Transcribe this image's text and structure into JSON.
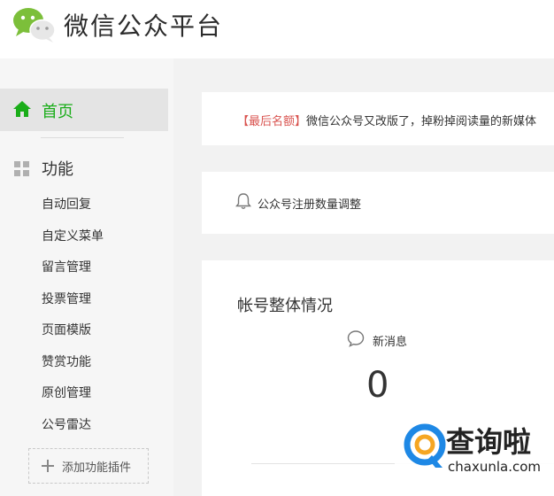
{
  "header": {
    "title": "微信公众平台",
    "logo_icon": "wechat-logo-icon"
  },
  "sidebar": {
    "home": {
      "label": "首页",
      "icon": "home-icon",
      "color": "#1aad19"
    },
    "function_section": {
      "label": "功能",
      "icon": "grid-icon"
    },
    "items": [
      {
        "label": "自动回复"
      },
      {
        "label": "自定义菜单"
      },
      {
        "label": "留言管理"
      },
      {
        "label": "投票管理"
      },
      {
        "label": "页面模版"
      },
      {
        "label": "赞赏功能"
      },
      {
        "label": "原创管理"
      },
      {
        "label": "公号雷达"
      }
    ],
    "add_plugin": {
      "label": "添加功能插件",
      "icon": "plus-icon"
    }
  },
  "main": {
    "notice": {
      "tag": "【最后名额】",
      "text": "微信公众号又改版了，掉粉掉阅读量的新媒体"
    },
    "announcement": {
      "label": "公众号注册数量调整",
      "icon": "bell-icon"
    },
    "overview": {
      "title": "帐号整体情况",
      "new_messages": {
        "label": "新消息",
        "count": "0",
        "icon": "message-bubble-icon"
      }
    }
  },
  "watermark": {
    "brand": "查询啦",
    "domain": "chaxunla.com"
  },
  "colors": {
    "accent": "#1aad19",
    "notice_tag": "#d9534f",
    "watermark_blue": "#1e88e5"
  }
}
